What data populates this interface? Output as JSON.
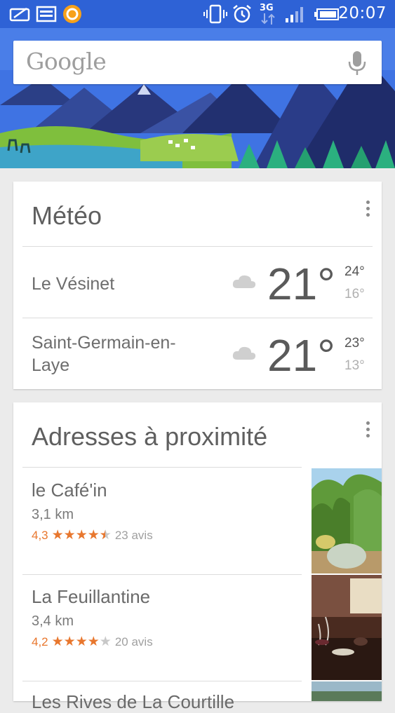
{
  "status_bar": {
    "time": "20:07",
    "network": "3G",
    "icons": [
      "notification-icon",
      "image-icon",
      "app-icon",
      "vibrate-icon",
      "alarm-icon",
      "network-3g-icon",
      "signal-icon",
      "battery-icon"
    ]
  },
  "search": {
    "logo_text": "Google",
    "mic_icon": "microphone-icon"
  },
  "weather_card": {
    "title": "Météo",
    "locations": [
      {
        "city": "Le Vésinet",
        "temp": "21°",
        "high": "24°",
        "low": "16°",
        "icon": "cloud-icon"
      },
      {
        "city": "Saint-Germain-en-Laye",
        "city_line1": "Saint-Germain-en-",
        "city_line2": "Laye",
        "temp": "21°",
        "high": "23°",
        "low": "13°",
        "icon": "cloud-icon"
      }
    ]
  },
  "nearby_card": {
    "title": "Adresses à proximité",
    "places": [
      {
        "name": "le Café'in",
        "distance": "3,1 km",
        "rating": "4,3",
        "stars": 4.3,
        "reviews": "23 avis"
      },
      {
        "name": "La Feuillantine",
        "distance": "3,4 km",
        "rating": "4,2",
        "stars": 4.2,
        "reviews": "20 avis"
      },
      {
        "name": "Les Rives de La Courtille"
      }
    ]
  },
  "colors": {
    "status_bar": "#2e62d6",
    "accent": "#e8772e",
    "background": "#ebebeb"
  }
}
